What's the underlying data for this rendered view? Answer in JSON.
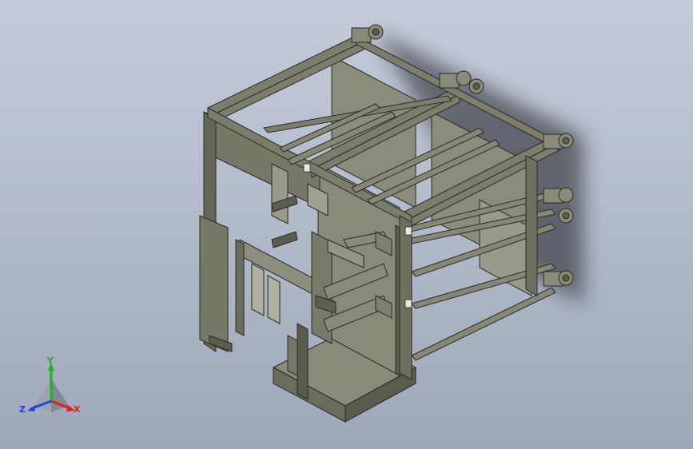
{
  "viewport": {
    "background_top": "#c4ccd9",
    "background_bottom": "#9ea8b9",
    "model_color": "#7f7f6f",
    "model_dark": "#5f5f50",
    "model_light": "#a4a494",
    "edge_color": "#2a2a26"
  },
  "triad": {
    "x_label": "X",
    "y_label": "Y",
    "z_label": "Z",
    "x_color": "#e02020",
    "y_color": "#20b020",
    "z_color": "#2040e0"
  }
}
